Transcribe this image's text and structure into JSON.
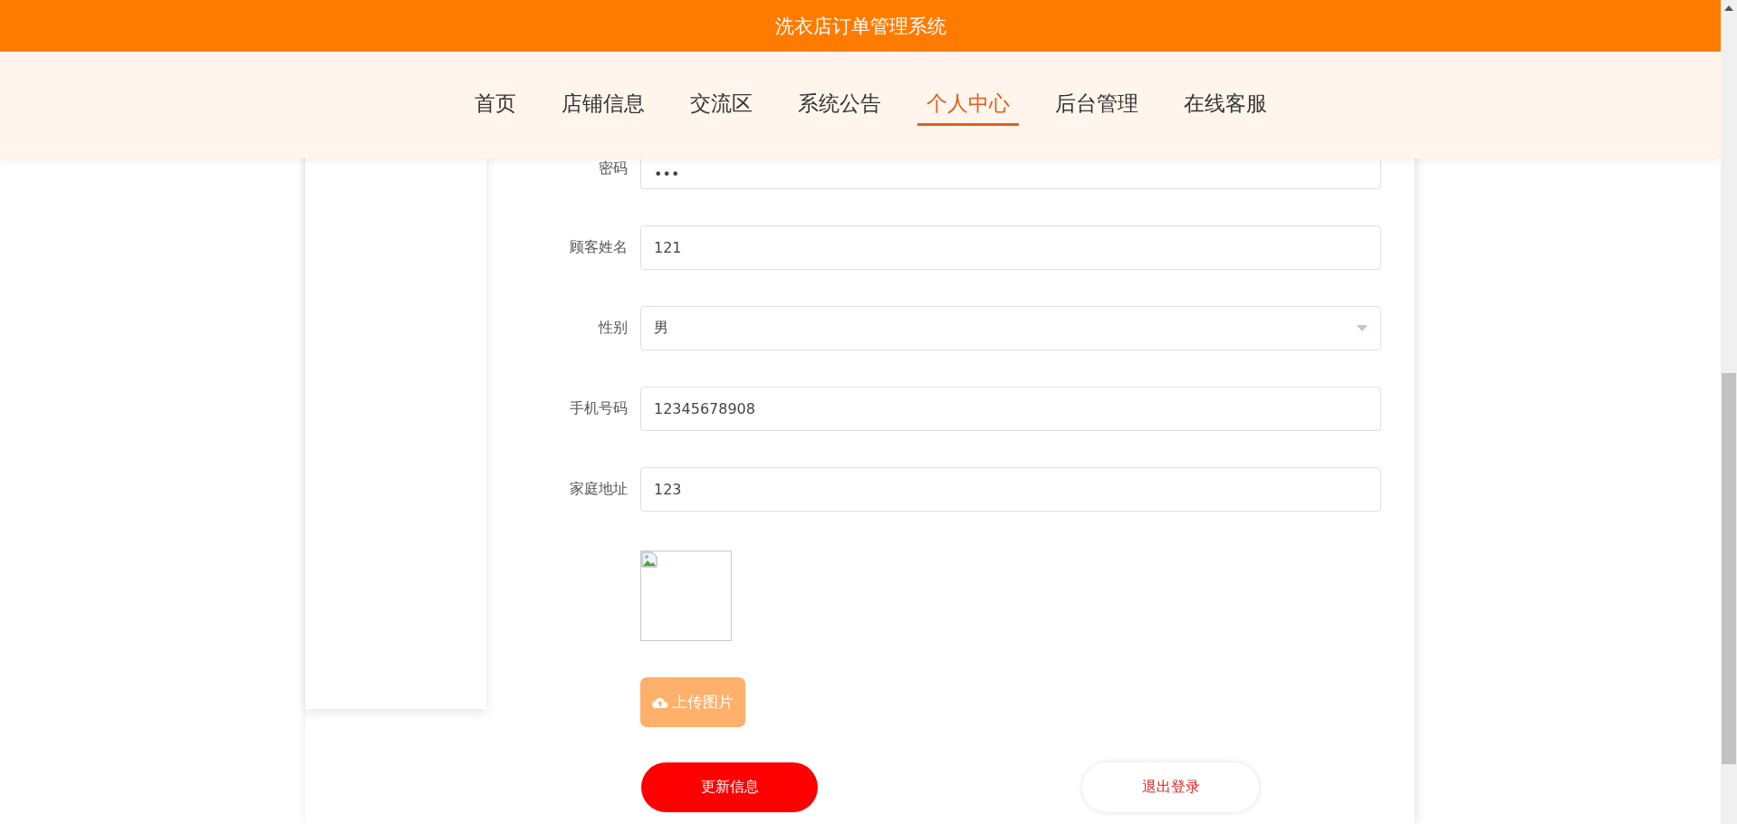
{
  "header": {
    "title": "洗衣店订单管理系统"
  },
  "nav": [
    {
      "label": "首页",
      "selected": false
    },
    {
      "label": "店铺信息",
      "selected": false
    },
    {
      "label": "交流区",
      "selected": false
    },
    {
      "label": "系统公告",
      "selected": false
    },
    {
      "label": "个人中心",
      "selected": true
    },
    {
      "label": "后台管理",
      "selected": false
    },
    {
      "label": "在线客服",
      "selected": false
    }
  ],
  "form": {
    "fields": [
      {
        "label": "密码",
        "kind": "text",
        "value": "•••"
      },
      {
        "label": "顾客姓名",
        "kind": "text",
        "value": "121"
      },
      {
        "label": "性别",
        "kind": "select",
        "value": "男"
      },
      {
        "label": "手机号码",
        "kind": "text",
        "value": "12345678908"
      },
      {
        "label": "家庭地址",
        "kind": "text",
        "value": "123"
      }
    ],
    "upload_button": "上传图片",
    "update_button": "更新信息",
    "logout_button": "退出登录"
  }
}
